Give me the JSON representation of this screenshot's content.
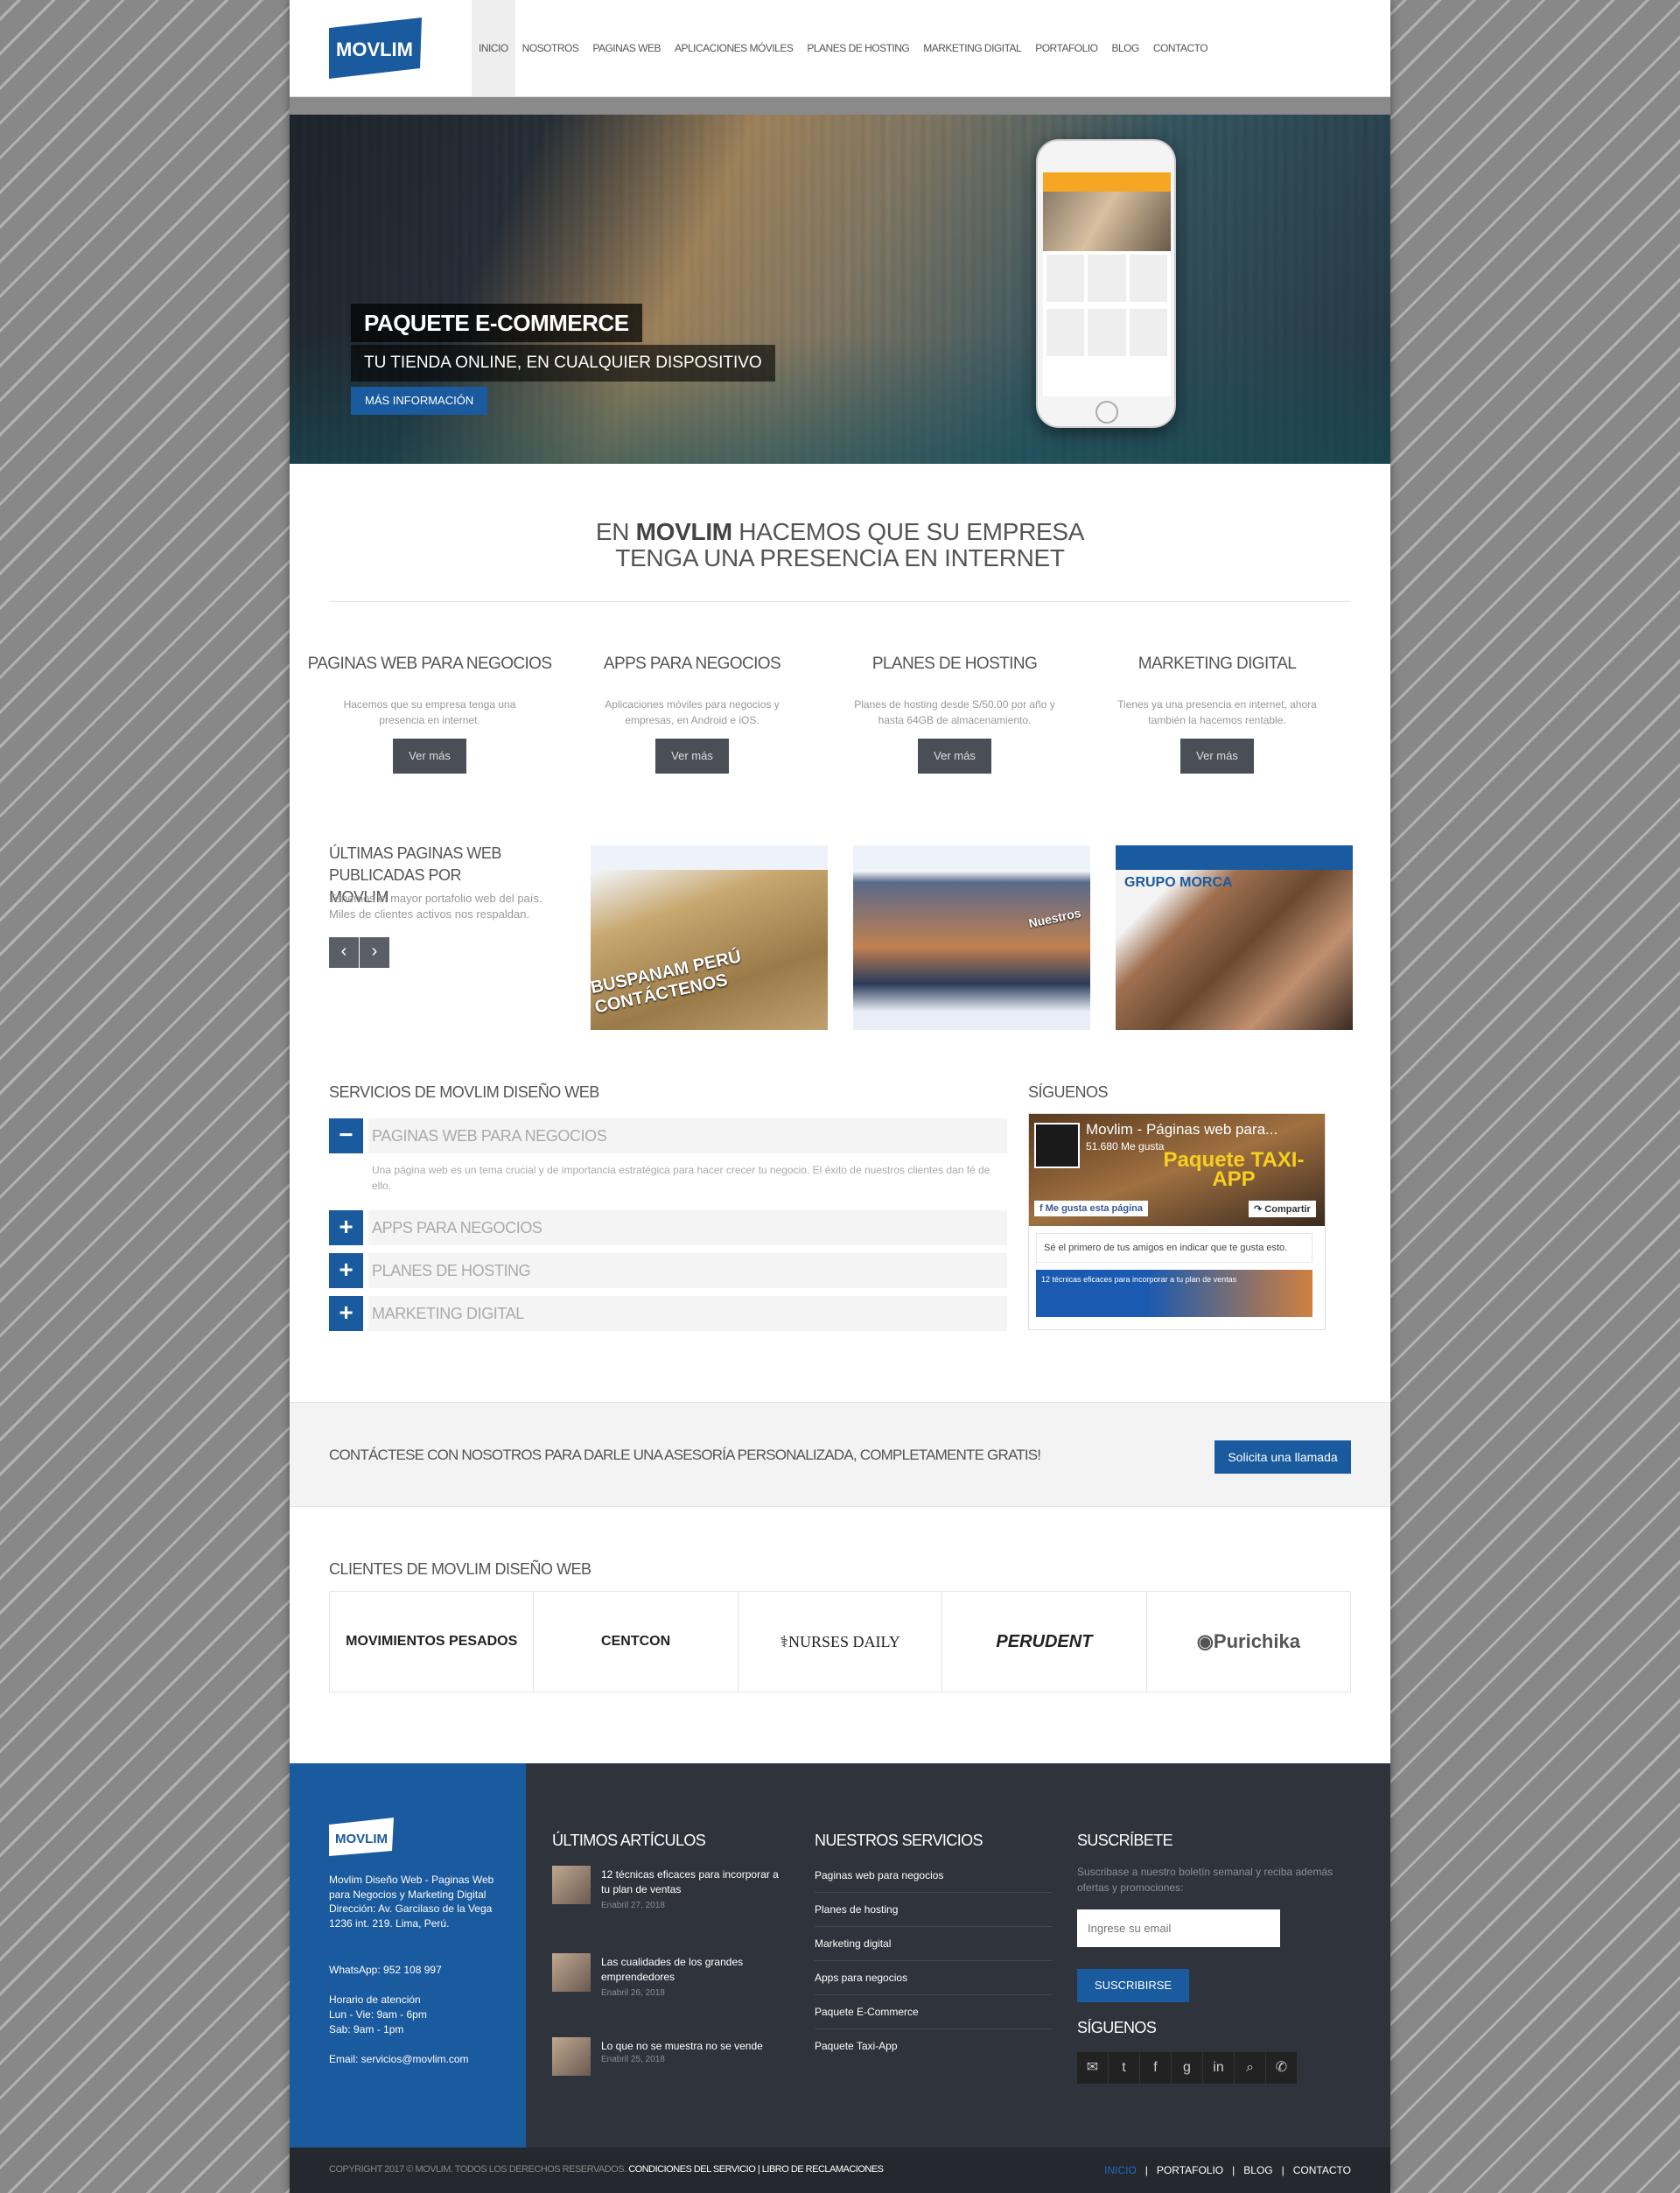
{
  "brand": {
    "name": "MOVLIM",
    "color": "#1a5a9e"
  },
  "nav": [
    "INICIO",
    "NOSOTROS",
    "PAGINAS WEB",
    "APLICACIONES MÓVILES",
    "PLANES DE HOSTING",
    "MARKETING DIGITAL",
    "PORTAFOLIO",
    "BLOG",
    "CONTACTO"
  ],
  "hero": {
    "title": "PAQUETE E-COMMERCE",
    "subtitle": "TU TIENDA ONLINE, EN CUALQUIER DISPOSITIVO",
    "button": "MÁS INFORMACIÓN"
  },
  "intro": {
    "pre": "EN ",
    "brand": "MOVLIM",
    "post": " HACEMOS QUE SU EMPRESA",
    "line2": "TENGA UNA PRESENCIA EN INTERNET"
  },
  "services": [
    {
      "title": "PAGINAS WEB PARA NEGOCIOS",
      "desc": "Hacemos que su empresa tenga una presencia en internet.",
      "button": "Ver más"
    },
    {
      "title": "APPS PARA NEGOCIOS",
      "desc": "Aplicaciones móviles para negocios y empresas, en Android e iOS.",
      "button": "Ver más"
    },
    {
      "title": "PLANES DE HOSTING",
      "desc": "Planes de hosting desde S/50.00 por año y hasta 64GB de almacenamiento.",
      "button": "Ver más"
    },
    {
      "title": "MARKETING DIGITAL",
      "desc": "Tienes ya una presencia en internet, ahora también la hacemos rentable.",
      "button": "Ver más"
    }
  ],
  "portfolio": {
    "title": "ÚLTIMAS PAGINAS WEB PUBLICADAS POR MOVLIM",
    "desc": "Tenemos el mayor portafolio web del país. Miles de clientes activos nos respaldan.",
    "items": [
      "BUSPANAM PERÚ CONTÁCTENOS",
      "Nuestros",
      "GRUPO MORCA"
    ]
  },
  "accordion": {
    "title": "SERVICIOS DE MOVLIM DISEÑO WEB",
    "items": [
      "PAGINAS WEB PARA NEGOCIOS",
      "APPS PARA NEGOCIOS",
      "PLANES DE HOSTING",
      "MARKETING DIGITAL"
    ],
    "body": "Una página web es un tema crucial y de importancia estratégica para hacer crecer tu negocio. El éxito de nuestros clientes dan fé de ello."
  },
  "follow": {
    "title": "SÍGUENOS",
    "fb_page": "Movlim - Páginas web para...",
    "fb_likes": "51.680 Me gusta",
    "fb_cover": "Paquete TAXI-APP",
    "fb_like_btn": "Me gusta esta página",
    "fb_share": "Compartir",
    "fb_text": "Sé el primero de tus amigos en indicar que te gusta esto.",
    "fb_post": "12 técnicas eficaces para incorporar a tu plan de ventas"
  },
  "cta": {
    "text": "CONTÁCTESE CON NOSOTROS PARA DARLE UNA ASESORÍA PERSONALIZADA, COMPLETAMENTE GRATIS!",
    "button": "Solicita una llamada"
  },
  "clients": {
    "title": "CLIENTES DE MOVLIM DISEÑO WEB",
    "items": [
      "MOVIMIENTOS PESADOS",
      "CENTCON",
      "NURSES DAILY",
      "PERUDENT",
      "Purichika"
    ]
  },
  "footer": {
    "about": "Movlim Diseño Web - Paginas Web para Negocios y Marketing Digital",
    "address": "Dirección: Av. Garcilaso de la Vega 1236 int. 219. Lima, Perú.",
    "whatsapp": "WhatsApp: 952 108 997",
    "hours_title": "Horario de atención",
    "hours1": "Lun - Vie: 9am - 6pm",
    "hours2": "Sab: 9am - 1pm",
    "email": "Email: servicios@movlim.com",
    "articles_title": "ÚLTIMOS ARTÍCULOS",
    "articles": [
      {
        "title": "12 técnicas eficaces para incorporar a tu plan de ventas",
        "date": "Enabril 27, 2018"
      },
      {
        "title": "Las cualidades de los grandes emprendedores",
        "date": "Enabril 26, 2018"
      },
      {
        "title": "Lo que no se muestra no se vende",
        "date": "Enabril 25, 2018"
      }
    ],
    "services_title": "NUESTROS SERVICIOS",
    "services": [
      "Paginas web para negocios",
      "Planes de hosting",
      "Marketing digital",
      "Apps para negocios",
      "Paquete E-Commerce",
      "Paquete Taxi-App"
    ],
    "subscribe_title": "SUSCRÍBETE",
    "subscribe_desc": "Suscribase a nuestro boletín semanal y reciba además ofertas y promociones:",
    "subscribe_placeholder": "Ingrese su email",
    "subscribe_button": "SUSCRIBIRSE",
    "follow_title": "SÍGUENOS",
    "social_icons": [
      "mail-icon",
      "twitter-icon",
      "facebook-icon",
      "google-plus-icon",
      "linkedin-icon",
      "search-icon",
      "whatsapp-icon"
    ]
  },
  "bottom": {
    "copy": "COPYRIGHT 2017 © MOVLIM. TODOS LOS DERECHOS RESERVADOS. ",
    "terms": "CONDICIONES DEL SERVICIO",
    "sep": " | ",
    "claims": "LIBRO DE RECLAMACIONES",
    "links": [
      "INICIO",
      "PORTAFOLIO",
      "BLOG",
      "CONTACTO"
    ]
  }
}
